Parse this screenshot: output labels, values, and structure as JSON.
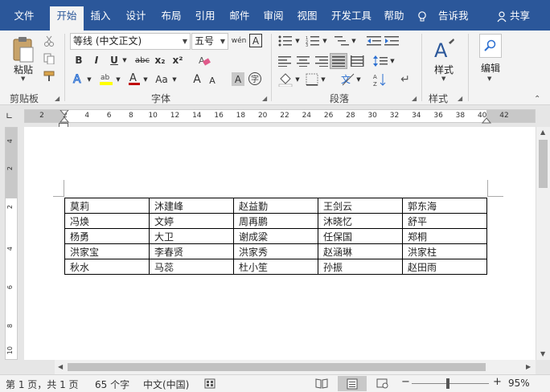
{
  "tabs": {
    "file": "文件",
    "home": "开始",
    "insert": "插入",
    "design": "设计",
    "layout": "布局",
    "references": "引用",
    "mailings": "邮件",
    "review": "审阅",
    "view": "视图",
    "developer": "开发工具",
    "help": "帮助"
  },
  "tell_me": "告诉我",
  "share": "共享",
  "clipboard": {
    "paste": "粘贴",
    "label": "剪贴板"
  },
  "font": {
    "name": "等线 (中文正文)",
    "size": "五号",
    "label": "字体",
    "bold": "B",
    "italic": "I",
    "underline": "U",
    "strike": "abc",
    "subscript": "x₂",
    "superscript": "x²",
    "change_case": "Aa",
    "grow": "A",
    "shrink": "A",
    "phonetic": "wén",
    "border_char": "A"
  },
  "paragraph": {
    "label": "段落"
  },
  "styles": {
    "button": "样式",
    "label": "样式"
  },
  "editing": {
    "button": "编辑"
  },
  "ruler": {
    "h_numbers": [
      "2",
      "2",
      "4",
      "6",
      "8",
      "10",
      "12",
      "14",
      "16",
      "18",
      "20",
      "22",
      "24",
      "26",
      "28",
      "30",
      "32",
      "34",
      "36",
      "38",
      "40",
      "42"
    ],
    "v_numbers": [
      "4",
      "2",
      "2",
      "4",
      "6",
      "8",
      "10"
    ]
  },
  "table": [
    [
      "莫莉",
      "沐建峰",
      "赵益勤",
      "王剑云",
      "郭东海"
    ],
    [
      "冯焕",
      "文婷",
      "周再鹏",
      "沐晓忆",
      "舒平"
    ],
    [
      "杨勇",
      "大卫",
      "谢成粱",
      "任保国",
      "郑桐"
    ],
    [
      "洪家宝",
      "李春贤",
      "洪家秀",
      "赵涵琳",
      "洪家柱"
    ],
    [
      "秋水",
      "马蕊",
      "杜小笙",
      "孙振",
      "赵田雨"
    ]
  ],
  "status": {
    "page": "第 1 页，共 1 页",
    "words": "65 个字",
    "language": "中文(中国)",
    "zoom": "95%",
    "zoom_minus": "−",
    "zoom_plus": "+"
  },
  "colors": {
    "brand": "#2b579a",
    "highlight": "#ffff00",
    "font_color": "#c00000"
  }
}
